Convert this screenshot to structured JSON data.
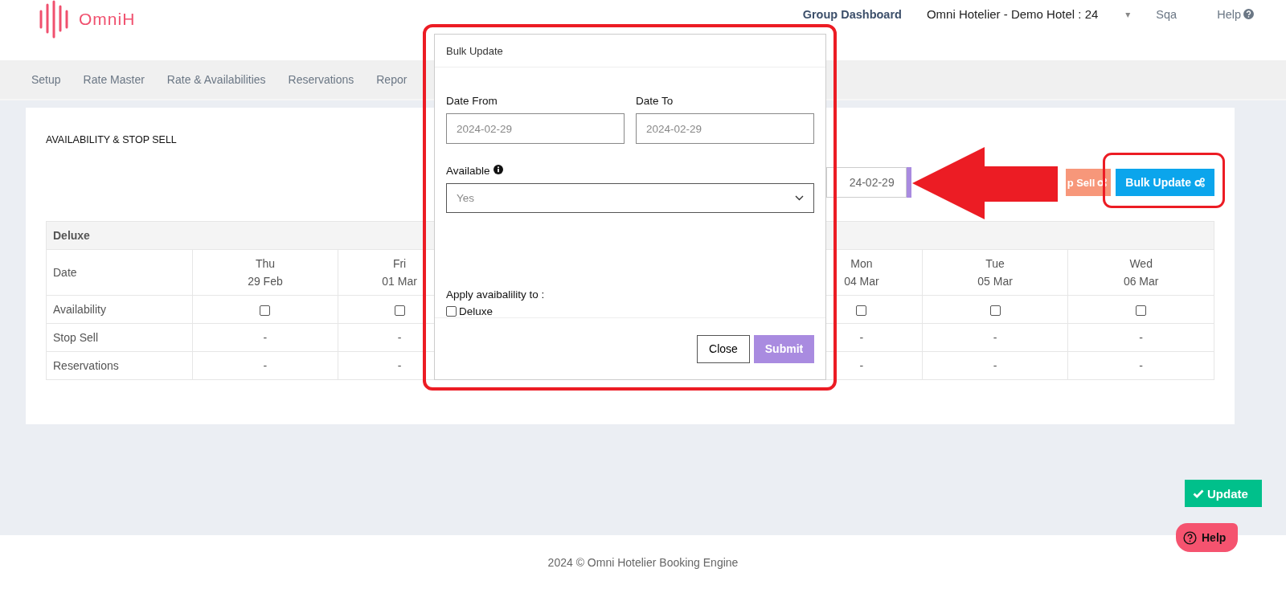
{
  "header": {
    "logo": "OmniH",
    "group_dashboard": "Group Dashboard",
    "hotel": "Omni Hotelier - Demo Hotel : 24",
    "caret": "▾",
    "user": "Sqa",
    "help": "Help"
  },
  "nav": [
    {
      "label": "Setup"
    },
    {
      "label": "Rate Master"
    },
    {
      "label": "Rate & Availabilities"
    },
    {
      "label": "Reservations"
    },
    {
      "label": "Repor"
    }
  ],
  "card": {
    "title": "AVAILABILITY & STOP SELL",
    "date_field": "24-02-29",
    "stop_sell_button": "p Sell",
    "bulk_update_button": "Bulk Update"
  },
  "table": {
    "room": "Deluxe",
    "row_labels": [
      "Date",
      "Availability",
      "Stop Sell",
      "Reservations"
    ],
    "columns": [
      {
        "day": "Thu",
        "date": "29 Feb",
        "checked": false,
        "stop_sell": "-",
        "reservations": "-"
      },
      {
        "day": "Fri",
        "date": "01 Mar",
        "checked": false,
        "stop_sell": "-",
        "reservations": "-"
      },
      {
        "day": "Mon",
        "date": "04 Mar",
        "checked": false,
        "stop_sell": "-",
        "reservations": "-"
      },
      {
        "day": "Tue",
        "date": "05 Mar",
        "checked": false,
        "stop_sell": "-",
        "reservations": "-"
      },
      {
        "day": "Wed",
        "date": "06 Mar",
        "checked": false,
        "stop_sell": "-",
        "reservations": "-"
      }
    ]
  },
  "modal": {
    "title": "Bulk Update",
    "date_from": {
      "label": "Date From",
      "value": "2024-02-29"
    },
    "date_to": {
      "label": "Date To",
      "value": "2024-02-29"
    },
    "available": {
      "label": "Available",
      "value": "Yes"
    },
    "apply_label": "Apply avaibalility to :",
    "rooms": [
      {
        "label": "Deluxe",
        "checked": false
      }
    ],
    "close_button": "Close",
    "submit_button": "Submit"
  },
  "update_button": "Update",
  "help_button": "Help",
  "footer": "2024 © Omni Hotelier Booking Engine"
}
